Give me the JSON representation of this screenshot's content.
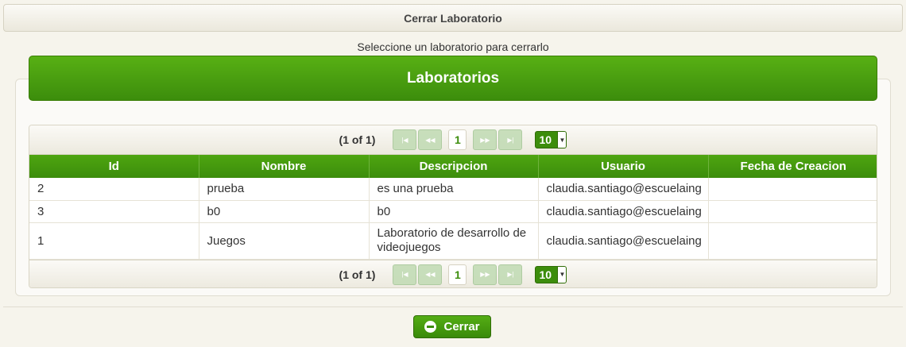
{
  "dialog": {
    "title": "Cerrar Laboratorio",
    "subtitle": "Seleccione un laboratorio para cerrarlo"
  },
  "panel": {
    "header": "Laboratorios"
  },
  "paginator": {
    "info": "(1 of 1)",
    "current_page": "1",
    "rows_per_page": "10",
    "buttons": {
      "first": "first-page-icon",
      "prev": "prev-page-icon",
      "next": "next-page-icon",
      "last": "last-page-icon"
    }
  },
  "table": {
    "columns": [
      "Id",
      "Nombre",
      "Descripcion",
      "Usuario",
      "Fecha de Creacion"
    ],
    "rows": [
      {
        "id": "2",
        "nombre": "prueba",
        "descripcion": "es una prueba",
        "usuario": "claudia.santiago@escuelaing",
        "fecha": ""
      },
      {
        "id": "3",
        "nombre": "b0",
        "descripcion": "b0",
        "usuario": "claudia.santiago@escuelaing",
        "fecha": ""
      },
      {
        "id": "1",
        "nombre": "Juegos",
        "descripcion": "Laboratorio de desarrollo de videojuegos",
        "usuario": "claudia.santiago@escuelaing",
        "fecha": ""
      }
    ]
  },
  "footer": {
    "close_label": "Cerrar",
    "close_icon": "minus-circle-icon"
  },
  "colors": {
    "accent": "#3c8d0c",
    "background": "#f6f4ec"
  }
}
